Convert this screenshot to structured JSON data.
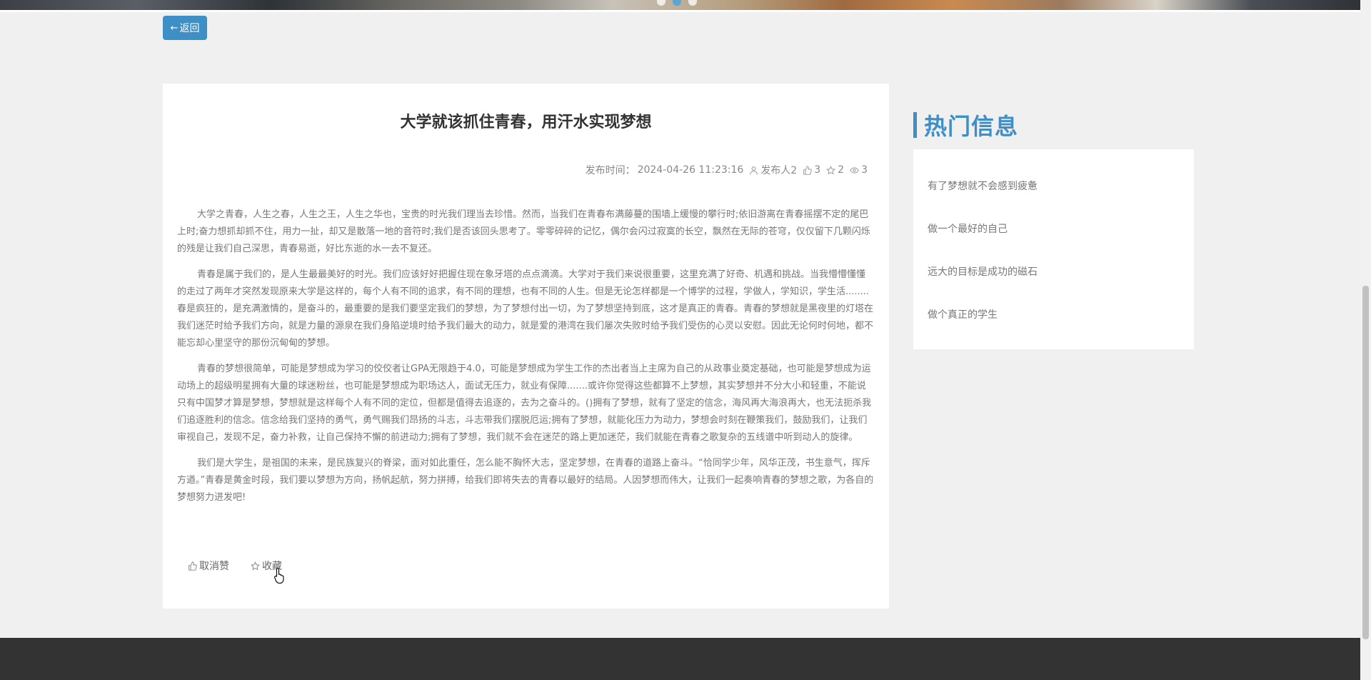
{
  "nav": {
    "back_label": "返回"
  },
  "article": {
    "title": "大学就该抓住青春，用汗水实现梦想",
    "publish_label": "发布时间：",
    "publish_time": "2024-04-26 11:23:16",
    "author": "发布人2",
    "likes": "3",
    "favorites": "2",
    "views": "3",
    "paragraphs": [
      "大学之青春，人生之春，人生之王，人生之华也，宝贵的时光我们理当去珍惜。然而，当我们在青春布满藤蔓的围墙上缓慢的攀行时;依旧游离在青春摇摆不定的尾巴上时;奋力想抓却抓不住，用力一扯，却又是散落一地的音符时;我们是否该回头思考了。零零碎碎的记忆，偶尔会闪过寂寞的长空，飘然在无际的苍穹，仅仅留下几颗闪烁的残是让我们自己深思，青春易逝，好比东逝的水一去不复还。",
      "青春是属于我们的，是人生最最美好的时光。我们应该好好把握住现在象牙塔的点点滴滴。大学对于我们来说很重要，这里充满了好奇、机遇和挑战。当我懵懵懂懂的走过了两年才突然发现原来大学是这样的，每个人有不同的追求，有不同的理想，也有不同的人生。但是无论怎样都是一个博学的过程，学做人，学知识，学生活........春是疯狂的，是充满激情的，是奋斗的，最重要的是我们要坚定我们的梦想，为了梦想付出一切，为了梦想坚持到底，这才是真正的青春。青春的梦想就是黑夜里的灯塔在我们迷茫时给予我们方向，就是力量的源泉在我们身陷逆境时给予我们最大的动力，就是爱的港湾在我们屡次失败时给予我们受伤的心灵以安慰。因此无论何时何地，都不能忘却心里坚守的那份沉甸甸的梦想。",
      "青春的梦想很简单，可能是梦想成为学习的佼佼者让GPA无限趋于4.0，可能是梦想成为学生工作的杰出者当上主席为自己的从政事业奠定基础，也可能是梦想成为运动场上的超级明星拥有大量的球迷粉丝，也可能是梦想成为职场达人，面试无压力，就业有保障.......或许你觉得这些都算不上梦想，其实梦想并不分大小和轻重，不能说只有中国梦才算是梦想，梦想就是这样每个人有不同的定位，但都是值得去追逐的，去为之奋斗的。()拥有了梦想，就有了坚定的信念，海风再大海浪再大，也无法扼杀我们追逐胜利的信念。信念给我们坚持的勇气，勇气赐我们昂扬的斗志，斗志带我们摆脱厄运;拥有了梦想，就能化压力为动力，梦想会时刻在鞭策我们，鼓励我们，让我们审视自己，发现不足，奋力补救，让自己保持不懈的前进动力;拥有了梦想，我们就不会在迷茫的路上更加迷茫，我们就能在青春之歌复杂的五线谱中听到动人的旋律。",
      "我们是大学生，是祖国的未来，是民族复兴的脊梁，面对如此重任，怎么能不胸怀大志，坚定梦想，在青春的道路上奋斗。“恰同学少年，风华正茂，书生意气，挥斥方遒。”青春是黄金时段，我们要以梦想为方向，扬帆起航，努力拼搏，给我们即将失去的青春以最好的结局。人因梦想而伟大，让我们一起奏响青春的梦想之歌，为各自的梦想努力进发吧!"
    ],
    "actions": {
      "unlike_label": "取消赞",
      "favorite_label": "收藏"
    }
  },
  "hot": {
    "title": "热门信息",
    "items": [
      {
        "label": "有了梦想就不会感到疲惫"
      },
      {
        "label": "做一个最好的自己"
      },
      {
        "label": "远大的目标是成功的磁石"
      },
      {
        "label": "做个真正的学生"
      }
    ]
  },
  "colors": {
    "accent": "#3d8fc6",
    "footer": "#333333",
    "background": "#f0f0f0"
  }
}
